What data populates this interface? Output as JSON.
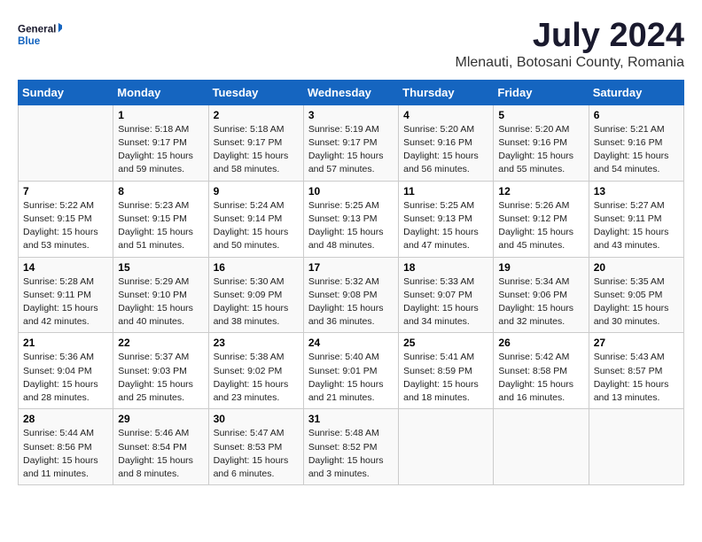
{
  "logo": {
    "general": "General",
    "blue": "Blue"
  },
  "title": "July 2024",
  "subtitle": "Mlenauti, Botosani County, Romania",
  "days_of_week": [
    "Sunday",
    "Monday",
    "Tuesday",
    "Wednesday",
    "Thursday",
    "Friday",
    "Saturday"
  ],
  "weeks": [
    [
      {
        "day": "",
        "info": ""
      },
      {
        "day": "1",
        "info": "Sunrise: 5:18 AM\nSunset: 9:17 PM\nDaylight: 15 hours\nand 59 minutes."
      },
      {
        "day": "2",
        "info": "Sunrise: 5:18 AM\nSunset: 9:17 PM\nDaylight: 15 hours\nand 58 minutes."
      },
      {
        "day": "3",
        "info": "Sunrise: 5:19 AM\nSunset: 9:17 PM\nDaylight: 15 hours\nand 57 minutes."
      },
      {
        "day": "4",
        "info": "Sunrise: 5:20 AM\nSunset: 9:16 PM\nDaylight: 15 hours\nand 56 minutes."
      },
      {
        "day": "5",
        "info": "Sunrise: 5:20 AM\nSunset: 9:16 PM\nDaylight: 15 hours\nand 55 minutes."
      },
      {
        "day": "6",
        "info": "Sunrise: 5:21 AM\nSunset: 9:16 PM\nDaylight: 15 hours\nand 54 minutes."
      }
    ],
    [
      {
        "day": "7",
        "info": "Sunrise: 5:22 AM\nSunset: 9:15 PM\nDaylight: 15 hours\nand 53 minutes."
      },
      {
        "day": "8",
        "info": "Sunrise: 5:23 AM\nSunset: 9:15 PM\nDaylight: 15 hours\nand 51 minutes."
      },
      {
        "day": "9",
        "info": "Sunrise: 5:24 AM\nSunset: 9:14 PM\nDaylight: 15 hours\nand 50 minutes."
      },
      {
        "day": "10",
        "info": "Sunrise: 5:25 AM\nSunset: 9:13 PM\nDaylight: 15 hours\nand 48 minutes."
      },
      {
        "day": "11",
        "info": "Sunrise: 5:25 AM\nSunset: 9:13 PM\nDaylight: 15 hours\nand 47 minutes."
      },
      {
        "day": "12",
        "info": "Sunrise: 5:26 AM\nSunset: 9:12 PM\nDaylight: 15 hours\nand 45 minutes."
      },
      {
        "day": "13",
        "info": "Sunrise: 5:27 AM\nSunset: 9:11 PM\nDaylight: 15 hours\nand 43 minutes."
      }
    ],
    [
      {
        "day": "14",
        "info": "Sunrise: 5:28 AM\nSunset: 9:11 PM\nDaylight: 15 hours\nand 42 minutes."
      },
      {
        "day": "15",
        "info": "Sunrise: 5:29 AM\nSunset: 9:10 PM\nDaylight: 15 hours\nand 40 minutes."
      },
      {
        "day": "16",
        "info": "Sunrise: 5:30 AM\nSunset: 9:09 PM\nDaylight: 15 hours\nand 38 minutes."
      },
      {
        "day": "17",
        "info": "Sunrise: 5:32 AM\nSunset: 9:08 PM\nDaylight: 15 hours\nand 36 minutes."
      },
      {
        "day": "18",
        "info": "Sunrise: 5:33 AM\nSunset: 9:07 PM\nDaylight: 15 hours\nand 34 minutes."
      },
      {
        "day": "19",
        "info": "Sunrise: 5:34 AM\nSunset: 9:06 PM\nDaylight: 15 hours\nand 32 minutes."
      },
      {
        "day": "20",
        "info": "Sunrise: 5:35 AM\nSunset: 9:05 PM\nDaylight: 15 hours\nand 30 minutes."
      }
    ],
    [
      {
        "day": "21",
        "info": "Sunrise: 5:36 AM\nSunset: 9:04 PM\nDaylight: 15 hours\nand 28 minutes."
      },
      {
        "day": "22",
        "info": "Sunrise: 5:37 AM\nSunset: 9:03 PM\nDaylight: 15 hours\nand 25 minutes."
      },
      {
        "day": "23",
        "info": "Sunrise: 5:38 AM\nSunset: 9:02 PM\nDaylight: 15 hours\nand 23 minutes."
      },
      {
        "day": "24",
        "info": "Sunrise: 5:40 AM\nSunset: 9:01 PM\nDaylight: 15 hours\nand 21 minutes."
      },
      {
        "day": "25",
        "info": "Sunrise: 5:41 AM\nSunset: 8:59 PM\nDaylight: 15 hours\nand 18 minutes."
      },
      {
        "day": "26",
        "info": "Sunrise: 5:42 AM\nSunset: 8:58 PM\nDaylight: 15 hours\nand 16 minutes."
      },
      {
        "day": "27",
        "info": "Sunrise: 5:43 AM\nSunset: 8:57 PM\nDaylight: 15 hours\nand 13 minutes."
      }
    ],
    [
      {
        "day": "28",
        "info": "Sunrise: 5:44 AM\nSunset: 8:56 PM\nDaylight: 15 hours\nand 11 minutes."
      },
      {
        "day": "29",
        "info": "Sunrise: 5:46 AM\nSunset: 8:54 PM\nDaylight: 15 hours\nand 8 minutes."
      },
      {
        "day": "30",
        "info": "Sunrise: 5:47 AM\nSunset: 8:53 PM\nDaylight: 15 hours\nand 6 minutes."
      },
      {
        "day": "31",
        "info": "Sunrise: 5:48 AM\nSunset: 8:52 PM\nDaylight: 15 hours\nand 3 minutes."
      },
      {
        "day": "",
        "info": ""
      },
      {
        "day": "",
        "info": ""
      },
      {
        "day": "",
        "info": ""
      }
    ]
  ]
}
